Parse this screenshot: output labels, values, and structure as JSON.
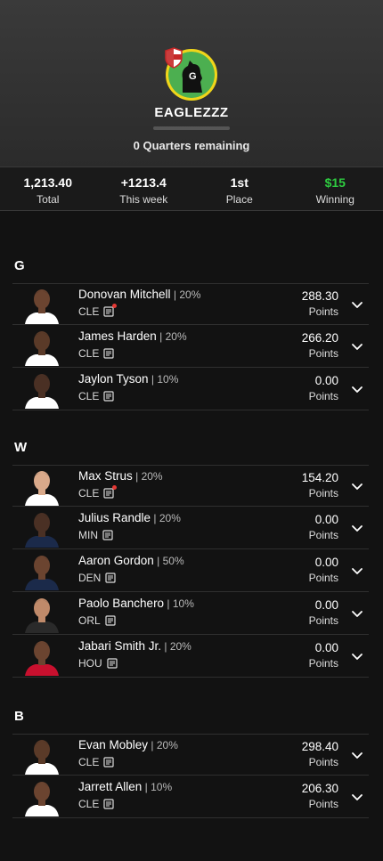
{
  "team": {
    "name": "EAGLEZZZ",
    "quarters_remaining": "0 Quarters remaining",
    "logo_letter": "G"
  },
  "stats": [
    {
      "value": "1,213.40",
      "label": "Total"
    },
    {
      "value": "+1213.4",
      "label": "This week"
    },
    {
      "value": "1st",
      "label": "Place"
    },
    {
      "value": "$15",
      "label": "Winning"
    }
  ],
  "colors": {
    "winning": "#2ecc40",
    "accent": "#f0d51a",
    "news_alert": "#e53935"
  },
  "sections": [
    {
      "label": "G",
      "players": [
        {
          "name": "Donovan Mitchell",
          "pct": "20%",
          "team": "CLE",
          "points": "288.30",
          "points_label": "Points",
          "news_alert": true,
          "jersey": "#ffffff",
          "skin": "#6b4430"
        },
        {
          "name": "James Harden",
          "pct": "20%",
          "team": "CLE",
          "points": "266.20",
          "points_label": "Points",
          "news_alert": false,
          "jersey": "#ffffff",
          "skin": "#5a3a28"
        },
        {
          "name": "Jaylon Tyson",
          "pct": "10%",
          "team": "CLE",
          "points": "0.00",
          "points_label": "Points",
          "news_alert": false,
          "jersey": "#ffffff",
          "skin": "#4a3024"
        }
      ]
    },
    {
      "label": "W",
      "players": [
        {
          "name": "Max Strus",
          "pct": "20%",
          "team": "CLE",
          "points": "154.20",
          "points_label": "Points",
          "news_alert": true,
          "jersey": "#ffffff",
          "skin": "#d9a98a"
        },
        {
          "name": "Julius Randle",
          "pct": "20%",
          "team": "MIN",
          "points": "0.00",
          "points_label": "Points",
          "news_alert": false,
          "jersey": "#1b2a4a",
          "skin": "#4a3024"
        },
        {
          "name": "Aaron Gordon",
          "pct": "50%",
          "team": "DEN",
          "points": "0.00",
          "points_label": "Points",
          "news_alert": false,
          "jersey": "#1b2a4a",
          "skin": "#6b4430"
        },
        {
          "name": "Paolo Banchero",
          "pct": "10%",
          "team": "ORL",
          "points": "0.00",
          "points_label": "Points",
          "news_alert": false,
          "jersey": "#2a2a2a",
          "skin": "#c08a6a"
        },
        {
          "name": "Jabari Smith Jr.",
          "pct": "20%",
          "team": "HOU",
          "points": "0.00",
          "points_label": "Points",
          "news_alert": false,
          "jersey": "#c8102e",
          "skin": "#6b4430"
        }
      ]
    },
    {
      "label": "B",
      "players": [
        {
          "name": "Evan Mobley",
          "pct": "20%",
          "team": "CLE",
          "points": "298.40",
          "points_label": "Points",
          "news_alert": false,
          "jersey": "#ffffff",
          "skin": "#5a3a28"
        },
        {
          "name": "Jarrett Allen",
          "pct": "10%",
          "team": "CLE",
          "points": "206.30",
          "points_label": "Points",
          "news_alert": false,
          "jersey": "#ffffff",
          "skin": "#6b4430"
        }
      ]
    }
  ]
}
